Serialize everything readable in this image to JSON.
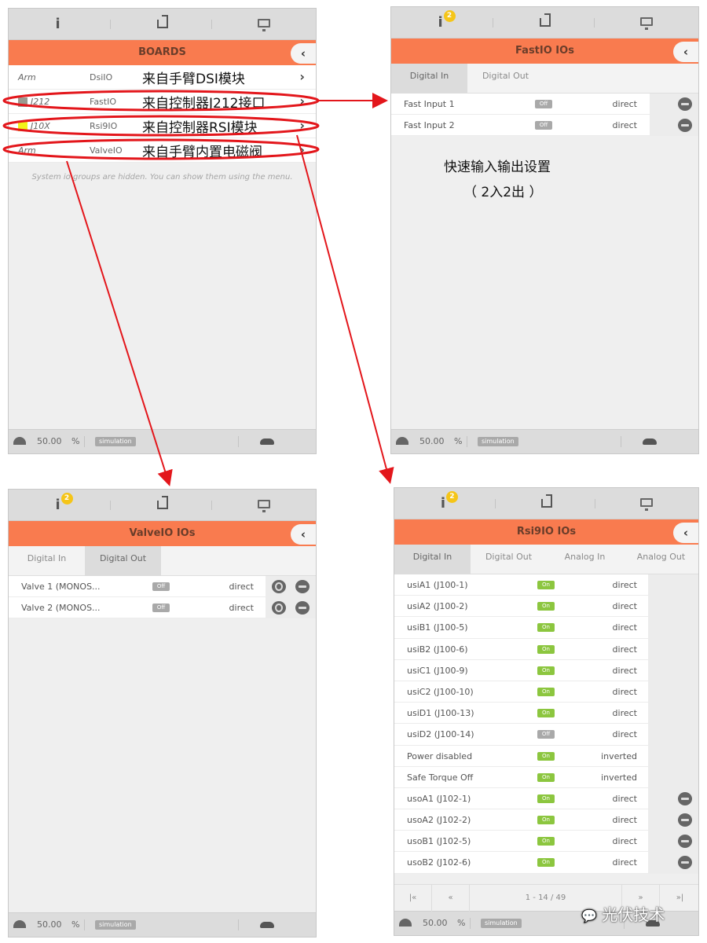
{
  "colors": {
    "accent": "#f97b4f",
    "on": "#8cc63f",
    "off": "#a9a9a9",
    "annotation": "#e3161b",
    "j212": "#9a9a90",
    "j10x": "#f2f21a"
  },
  "topbar": {
    "icons": [
      "info-icon",
      "factory-icon",
      "monitor-icon"
    ],
    "notification_count": "2"
  },
  "footer": {
    "override": "50.00",
    "unit": "%",
    "mode": "simulation"
  },
  "boards": {
    "title": "BOARDS",
    "back": "‹",
    "rows": [
      {
        "location": "Arm",
        "name": "DsiIO",
        "annotation": "来自手臂DSI模块"
      },
      {
        "location": "J212",
        "name": "FastIO",
        "annotation": "来自控制器J212接口",
        "color": "#9a9a90"
      },
      {
        "location": "J10X",
        "name": "Rsi9IO",
        "annotation": "来自控制器RSI模块",
        "color": "#f2f21a"
      },
      {
        "location": "Arm",
        "name": "ValveIO",
        "annotation": "来自手臂内置电磁阀"
      }
    ],
    "note": "System io groups are hidden. You can show them using the menu."
  },
  "fastio": {
    "title": "FastIO IOs",
    "tabs": [
      "Digital In",
      "Digital Out"
    ],
    "active_tab": 0,
    "rows": [
      {
        "name": "Fast Input 1",
        "state": "Off",
        "mode": "direct",
        "actions": [
          "key"
        ]
      },
      {
        "name": "Fast Input 2",
        "state": "Off",
        "mode": "direct",
        "actions": [
          "key"
        ]
      }
    ],
    "annotation_line1": "快速输入输出设置",
    "annotation_line2": "（ 2入2出 ）"
  },
  "valve": {
    "title": "ValveIO IOs",
    "tabs": [
      "Digital In",
      "Digital Out"
    ],
    "active_tab": 1,
    "rows": [
      {
        "name": "Valve 1 (MONOS...",
        "state": "Off",
        "mode": "direct",
        "actions": [
          "power",
          "key"
        ]
      },
      {
        "name": "Valve 2 (MONOS...",
        "state": "Off",
        "mode": "direct",
        "actions": [
          "power",
          "key"
        ]
      }
    ]
  },
  "rsi": {
    "title": "Rsi9IO IOs",
    "tabs": [
      "Digital In",
      "Digital Out",
      "Analog In",
      "Analog Out"
    ],
    "active_tab": 0,
    "rows": [
      {
        "name": "usiA1 (J100-1)",
        "state": "On",
        "mode": "direct",
        "actions": []
      },
      {
        "name": "usiA2 (J100-2)",
        "state": "On",
        "mode": "direct",
        "actions": []
      },
      {
        "name": "usiB1 (J100-5)",
        "state": "On",
        "mode": "direct",
        "actions": []
      },
      {
        "name": "usiB2 (J100-6)",
        "state": "On",
        "mode": "direct",
        "actions": []
      },
      {
        "name": "usiC1 (J100-9)",
        "state": "On",
        "mode": "direct",
        "actions": []
      },
      {
        "name": "usiC2 (J100-10)",
        "state": "On",
        "mode": "direct",
        "actions": []
      },
      {
        "name": "usiD1 (J100-13)",
        "state": "On",
        "mode": "direct",
        "actions": []
      },
      {
        "name": "usiD2 (J100-14)",
        "state": "Off",
        "mode": "direct",
        "actions": []
      },
      {
        "name": "Power disabled",
        "state": "On",
        "mode": "inverted",
        "actions": []
      },
      {
        "name": "Safe Torque Off",
        "state": "On",
        "mode": "inverted",
        "actions": []
      },
      {
        "name": "usoA1 (J102-1)",
        "state": "On",
        "mode": "direct",
        "actions": [
          "key"
        ]
      },
      {
        "name": "usoA2 (J102-2)",
        "state": "On",
        "mode": "direct",
        "actions": [
          "key"
        ]
      },
      {
        "name": "usoB1 (J102-5)",
        "state": "On",
        "mode": "direct",
        "actions": [
          "key"
        ]
      },
      {
        "name": "usoB2 (J102-6)",
        "state": "On",
        "mode": "direct",
        "actions": [
          "key"
        ]
      }
    ],
    "pager": {
      "first": "|«",
      "prev": "«",
      "range": "1 - 14 / 49",
      "next": "»",
      "last": "»|"
    }
  },
  "watermark": "光伏技术"
}
